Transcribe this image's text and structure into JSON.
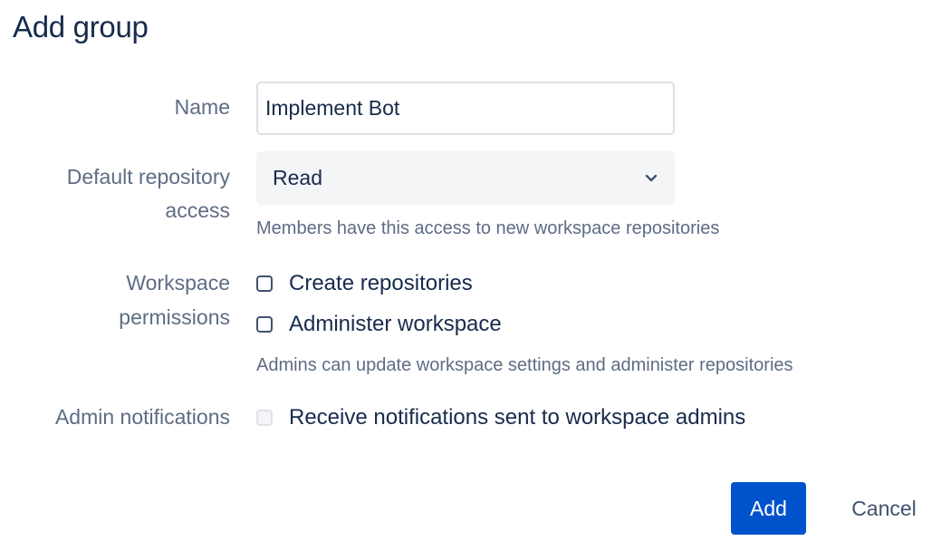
{
  "dialog": {
    "title": "Add group"
  },
  "form": {
    "name": {
      "label": "Name",
      "value": "Implement Bot"
    },
    "repo_access": {
      "label_line1": "Default repository",
      "label_line2": "access",
      "selected": "Read",
      "help": "Members have this access to new workspace repositories"
    },
    "permissions": {
      "label_line1": "Workspace",
      "label_line2": "permissions",
      "options": [
        {
          "label": "Create repositories",
          "checked": false
        },
        {
          "label": "Administer workspace",
          "checked": false
        }
      ],
      "help": "Admins can update workspace settings and administer repositories"
    },
    "notifications": {
      "label": "Admin notifications",
      "option_label": "Receive notifications sent to workspace admins",
      "checked": false,
      "disabled": true
    }
  },
  "actions": {
    "add_label": "Add",
    "cancel_label": "Cancel"
  },
  "colors": {
    "primary": "#0052cc",
    "text": "#172b4d",
    "subtle_text": "#5e6c84"
  }
}
